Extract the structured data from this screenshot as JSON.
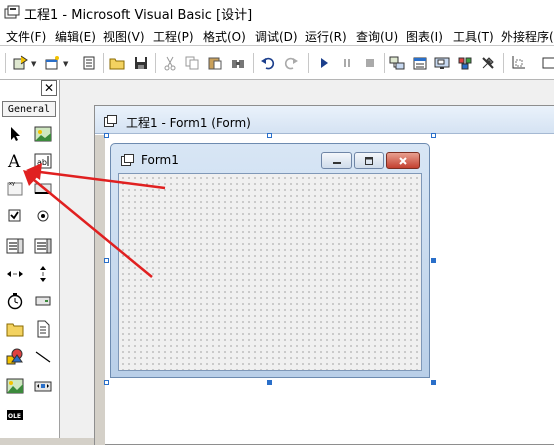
{
  "window": {
    "title": "工程1 - Microsoft Visual Basic [设计]"
  },
  "menu": {
    "items": [
      "文件(F)",
      "编辑(E)",
      "视图(V)",
      "工程(P)",
      "格式(O)",
      "调试(D)",
      "运行(R)",
      "查询(U)",
      "图表(I)",
      "工具(T)",
      "外接程序("
    ]
  },
  "toolbar": {
    "icons": [
      "add-project-icon",
      "add-form-icon",
      "menu-editor-icon",
      "open-icon",
      "save-icon",
      "cut-icon",
      "copy-icon",
      "paste-icon",
      "find-icon",
      "undo-icon",
      "redo-icon",
      "start-icon",
      "break-icon",
      "end-icon",
      "project-explorer-icon",
      "properties-icon",
      "form-layout-icon",
      "object-browser-icon",
      "toolbox-icon"
    ]
  },
  "toolbox": {
    "close_label": "✕",
    "tab_label": "General",
    "items": [
      "pointer",
      "picturebox",
      "label",
      "textbox",
      "frame",
      "commandbutton",
      "checkbox",
      "optionbutton",
      "combobox",
      "listbox",
      "hscrollbar",
      "vscrollbar",
      "timer",
      "drivelistbox",
      "dirlistbox",
      "filelistbox",
      "shape",
      "line",
      "image",
      "data",
      "ole"
    ]
  },
  "designer": {
    "title": "工程1 - Form1 (Form)"
  },
  "form": {
    "title": "Form1"
  },
  "colors": {
    "annotation_arrow": "#e02020",
    "selection_handle": "#2a6fc9"
  }
}
